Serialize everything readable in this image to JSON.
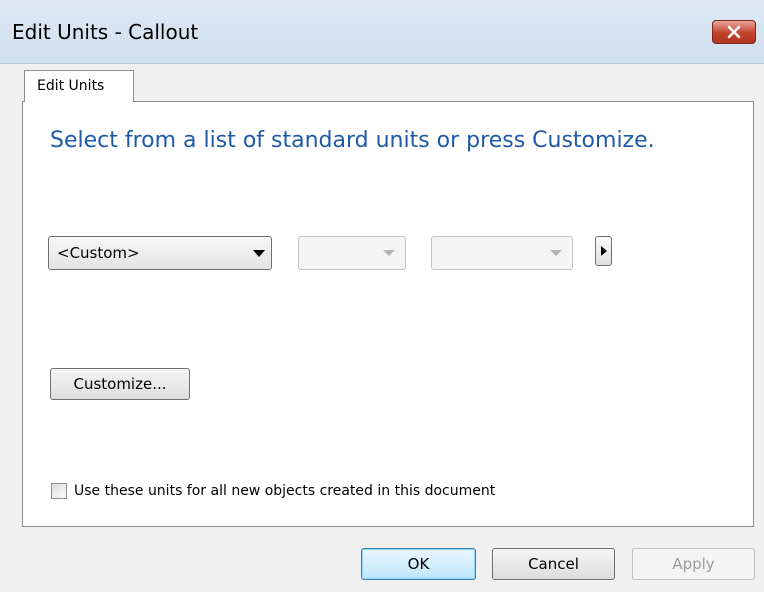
{
  "window": {
    "title": "Edit Units - Callout"
  },
  "tabs": [
    {
      "label": "Edit Units"
    }
  ],
  "main": {
    "heading": "Select from a list of standard units or press Customize.",
    "unit_select": {
      "value": "<Custom>"
    },
    "second_select": {
      "value": ""
    },
    "third_select": {
      "value": ""
    },
    "customize_label": "Customize...",
    "checkbox_label": "Use these units for all new objects created in this document",
    "checkbox_checked": false
  },
  "footer": {
    "ok_label": "OK",
    "cancel_label": "Cancel",
    "apply_label": "Apply"
  },
  "colors": {
    "heading": "#1e5aa8",
    "close_button": "#c2422c"
  },
  "icons": {
    "close": "close-icon",
    "dropdown": "chevron-down-icon",
    "expand": "chevron-right-icon"
  }
}
